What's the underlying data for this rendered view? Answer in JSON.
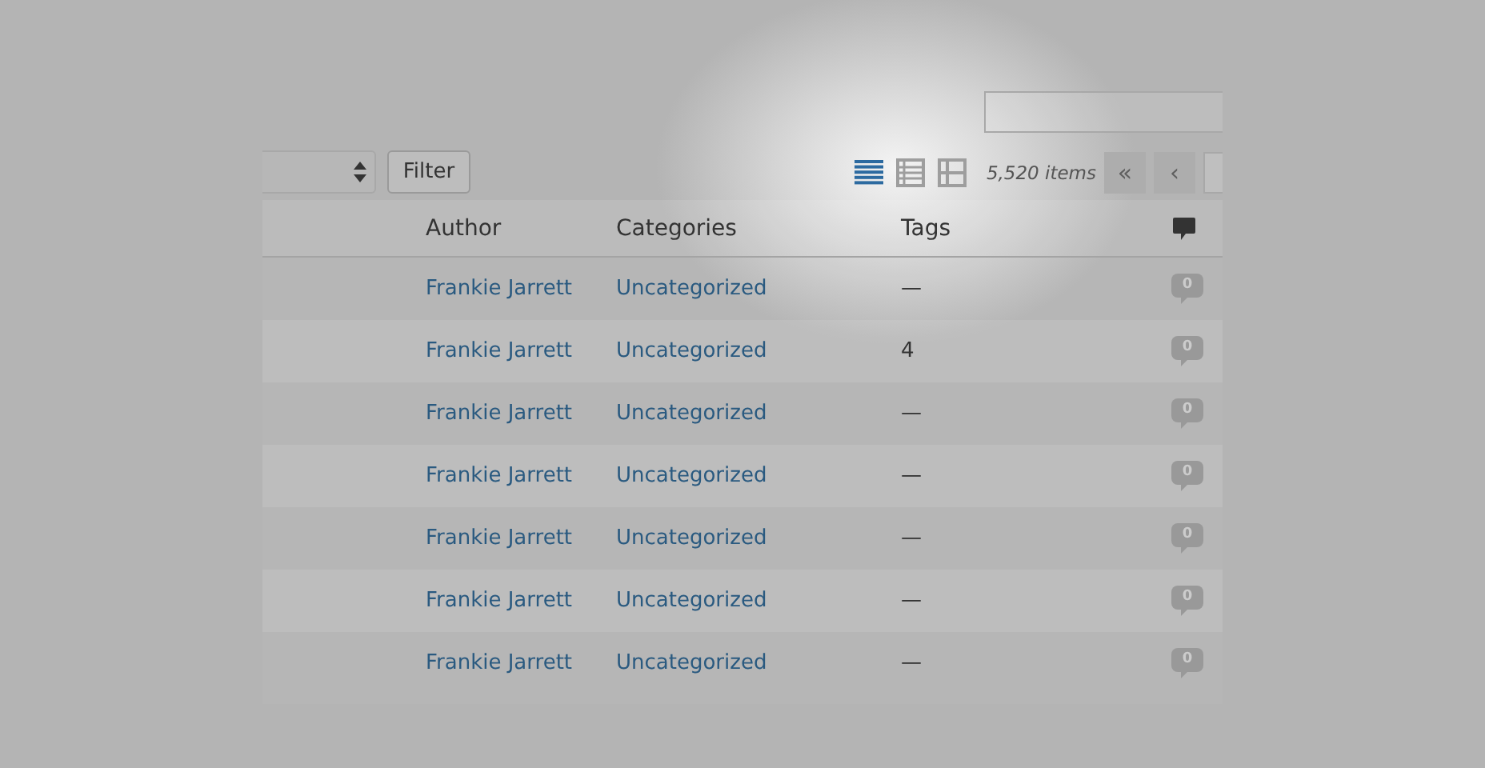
{
  "toolbar": {
    "filter_button": "Filter",
    "view_modes": [
      {
        "kind": "list",
        "selected": true
      },
      {
        "kind": "excerpt",
        "selected": false
      },
      {
        "kind": "grid",
        "selected": false
      }
    ],
    "item_count": "5,520 items",
    "pagination": [
      {
        "label": "«",
        "disabled": true
      },
      {
        "label": "‹",
        "disabled": true
      }
    ]
  },
  "table": {
    "columns": [
      "Author",
      "Categories",
      "Tags"
    ],
    "rows": [
      {
        "author": "Frankie Jarrett",
        "categories": "Uncategorized",
        "tags": "—",
        "comments": "0"
      },
      {
        "author": "Frankie Jarrett",
        "categories": "Uncategorized",
        "tags": "4",
        "comments": "0"
      },
      {
        "author": "Frankie Jarrett",
        "categories": "Uncategorized",
        "tags": "—",
        "comments": "0"
      },
      {
        "author": "Frankie Jarrett",
        "categories": "Uncategorized",
        "tags": "—",
        "comments": "0"
      },
      {
        "author": "Frankie Jarrett",
        "categories": "Uncategorized",
        "tags": "—",
        "comments": "0"
      },
      {
        "author": "Frankie Jarrett",
        "categories": "Uncategorized",
        "tags": "—",
        "comments": "0"
      },
      {
        "author": "Frankie Jarrett",
        "categories": "Uncategorized",
        "tags": "—",
        "comments": "0"
      }
    ]
  }
}
